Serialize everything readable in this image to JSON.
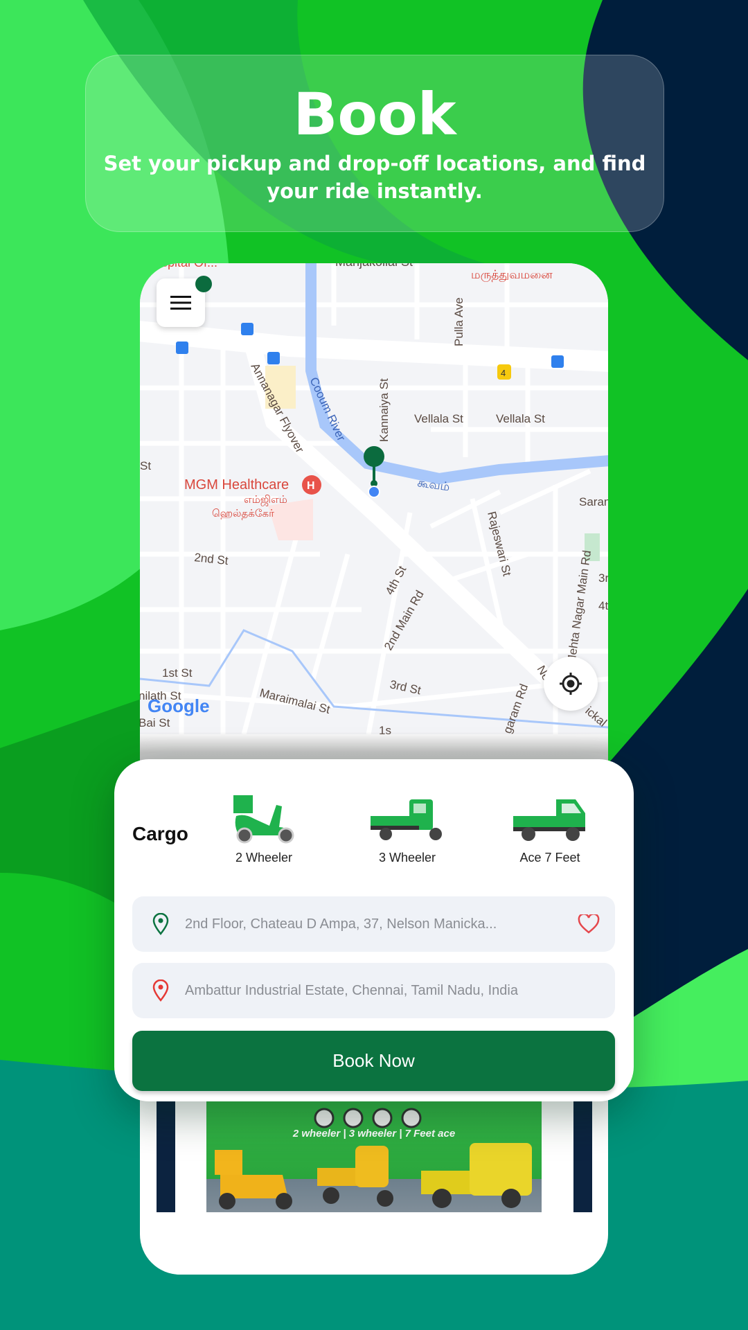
{
  "hero": {
    "title": "Book",
    "subtitle": "Set your pickup and drop-off locations, and find your ride instantly."
  },
  "map": {
    "labels": [
      "t Hospital Of...",
      "Manjakollai St",
      "மருத்துவமனை",
      "Pulla Ave",
      "Annanagar Flyover",
      "Cooum River",
      "Kannaiya St",
      "Vellala St",
      "Vellala St",
      "St",
      "MGM Healthcare",
      "எம்ஜிஎம்",
      "ஹெல்தக்கேர்",
      "கூவம்",
      "Saran",
      "Rajeswari St",
      "2nd St",
      "4th St",
      "2nd Main Rd",
      "Mehta Nagar Main Rd",
      "3r",
      "4t",
      "1st St",
      "3rd St",
      "Maraimalai St",
      "nilath St",
      "Bai St",
      "garam Rd",
      "Ne",
      "ickal",
      "1s"
    ],
    "route_badge": "4",
    "logo": "Google",
    "menu_icon": "hamburger-menu-icon",
    "locate_icon": "my-location-icon"
  },
  "booking": {
    "category": "Cargo",
    "vehicles": [
      {
        "label": "2 Wheeler",
        "icon": "scooter-icon"
      },
      {
        "label": "3 Wheeler",
        "icon": "three-wheeler-icon"
      },
      {
        "label": "Ace 7 Feet",
        "icon": "mini-truck-icon"
      }
    ],
    "pickup": "2nd Floor, Chateau D Ampa, 37, Nelson Manicka...",
    "drop": "Ambattur Industrial Estate, Chennai, Tamil Nadu, India",
    "book_label": "Book Now"
  },
  "banner": {
    "tagline": "2 wheeler | 3 wheeler | 7 Feet ace"
  },
  "colors": {
    "primary": "#0b7340",
    "pickup_pin": "#0b7340",
    "drop_pin": "#e53935",
    "favorite": "#e5484d",
    "background_green": "#11c225",
    "background_navy": "#001e3c",
    "background_teal": "#00937a"
  }
}
